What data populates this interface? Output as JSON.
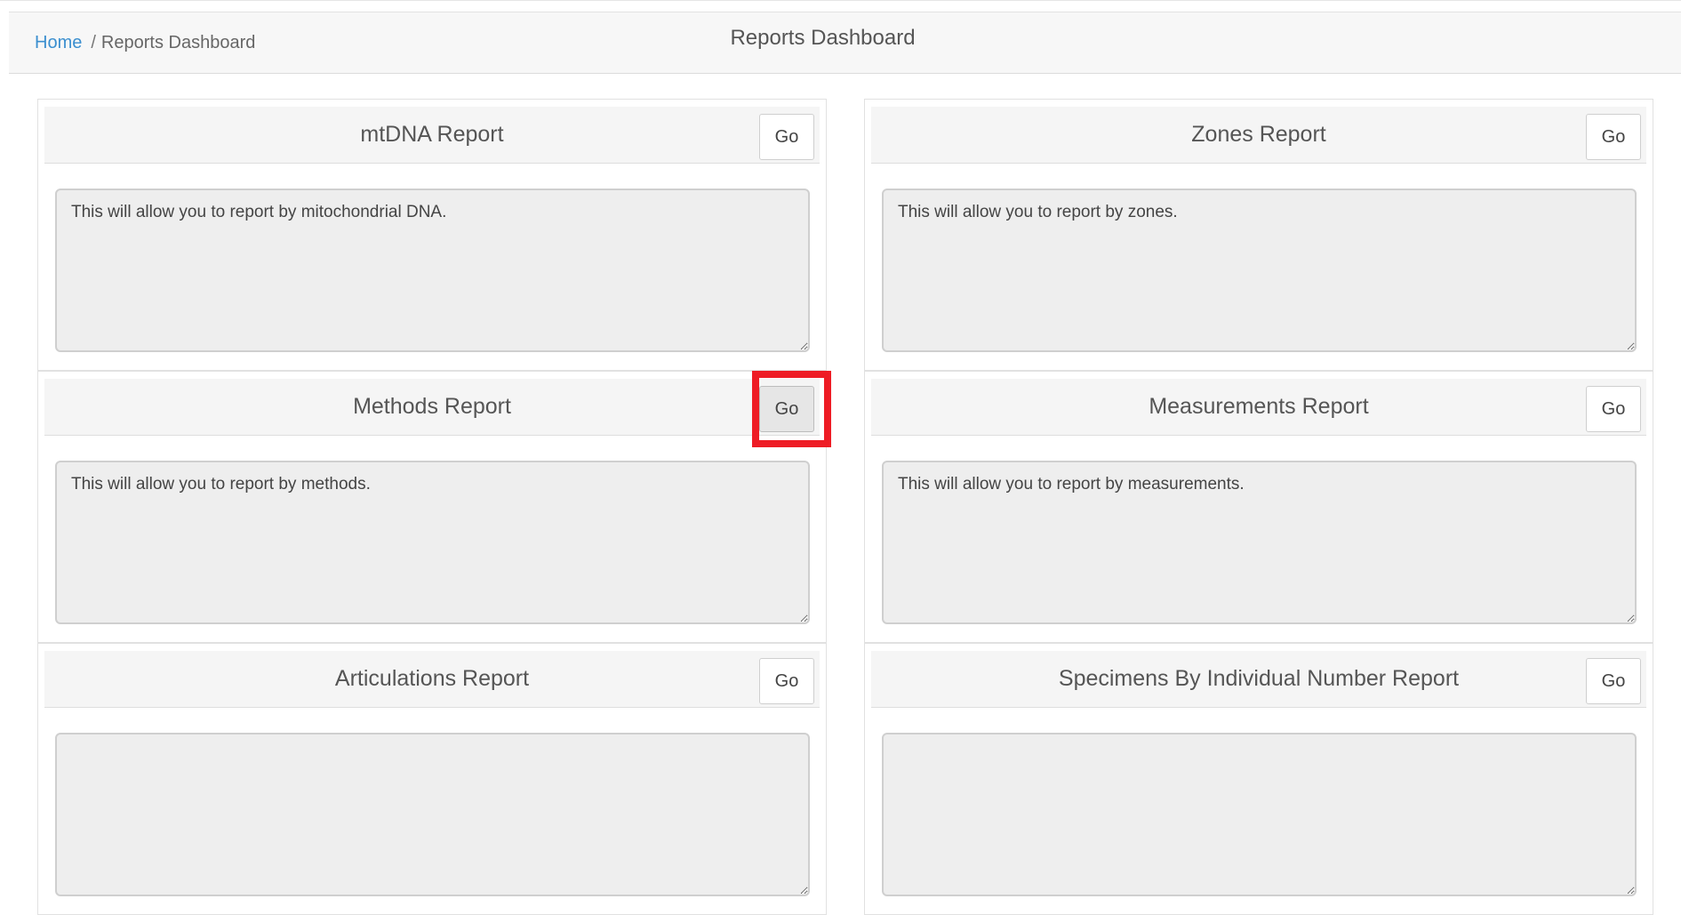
{
  "breadcrumb": {
    "home": "Home",
    "separator": "/",
    "current": "Reports Dashboard"
  },
  "page_title": "Reports Dashboard",
  "reports": [
    {
      "title": "mtDNA Report",
      "go": "Go",
      "description": "This will allow you to report by mitochondrial DNA."
    },
    {
      "title": "Zones Report",
      "go": "Go",
      "description": "This will allow you to report by zones."
    },
    {
      "title": "Methods Report",
      "go": "Go",
      "description": "This will allow you to report by methods."
    },
    {
      "title": "Measurements Report",
      "go": "Go",
      "description": "This will allow you to report by measurements."
    },
    {
      "title": "Articulations Report",
      "go": "Go",
      "description": ""
    },
    {
      "title": "Specimens By Individual Number Report",
      "go": "Go",
      "description": ""
    }
  ],
  "colors": {
    "link": "#3b8fcf",
    "highlight": "#ee1c25",
    "header_bg": "#f7f7f7",
    "textarea_bg": "#eeeeee"
  }
}
